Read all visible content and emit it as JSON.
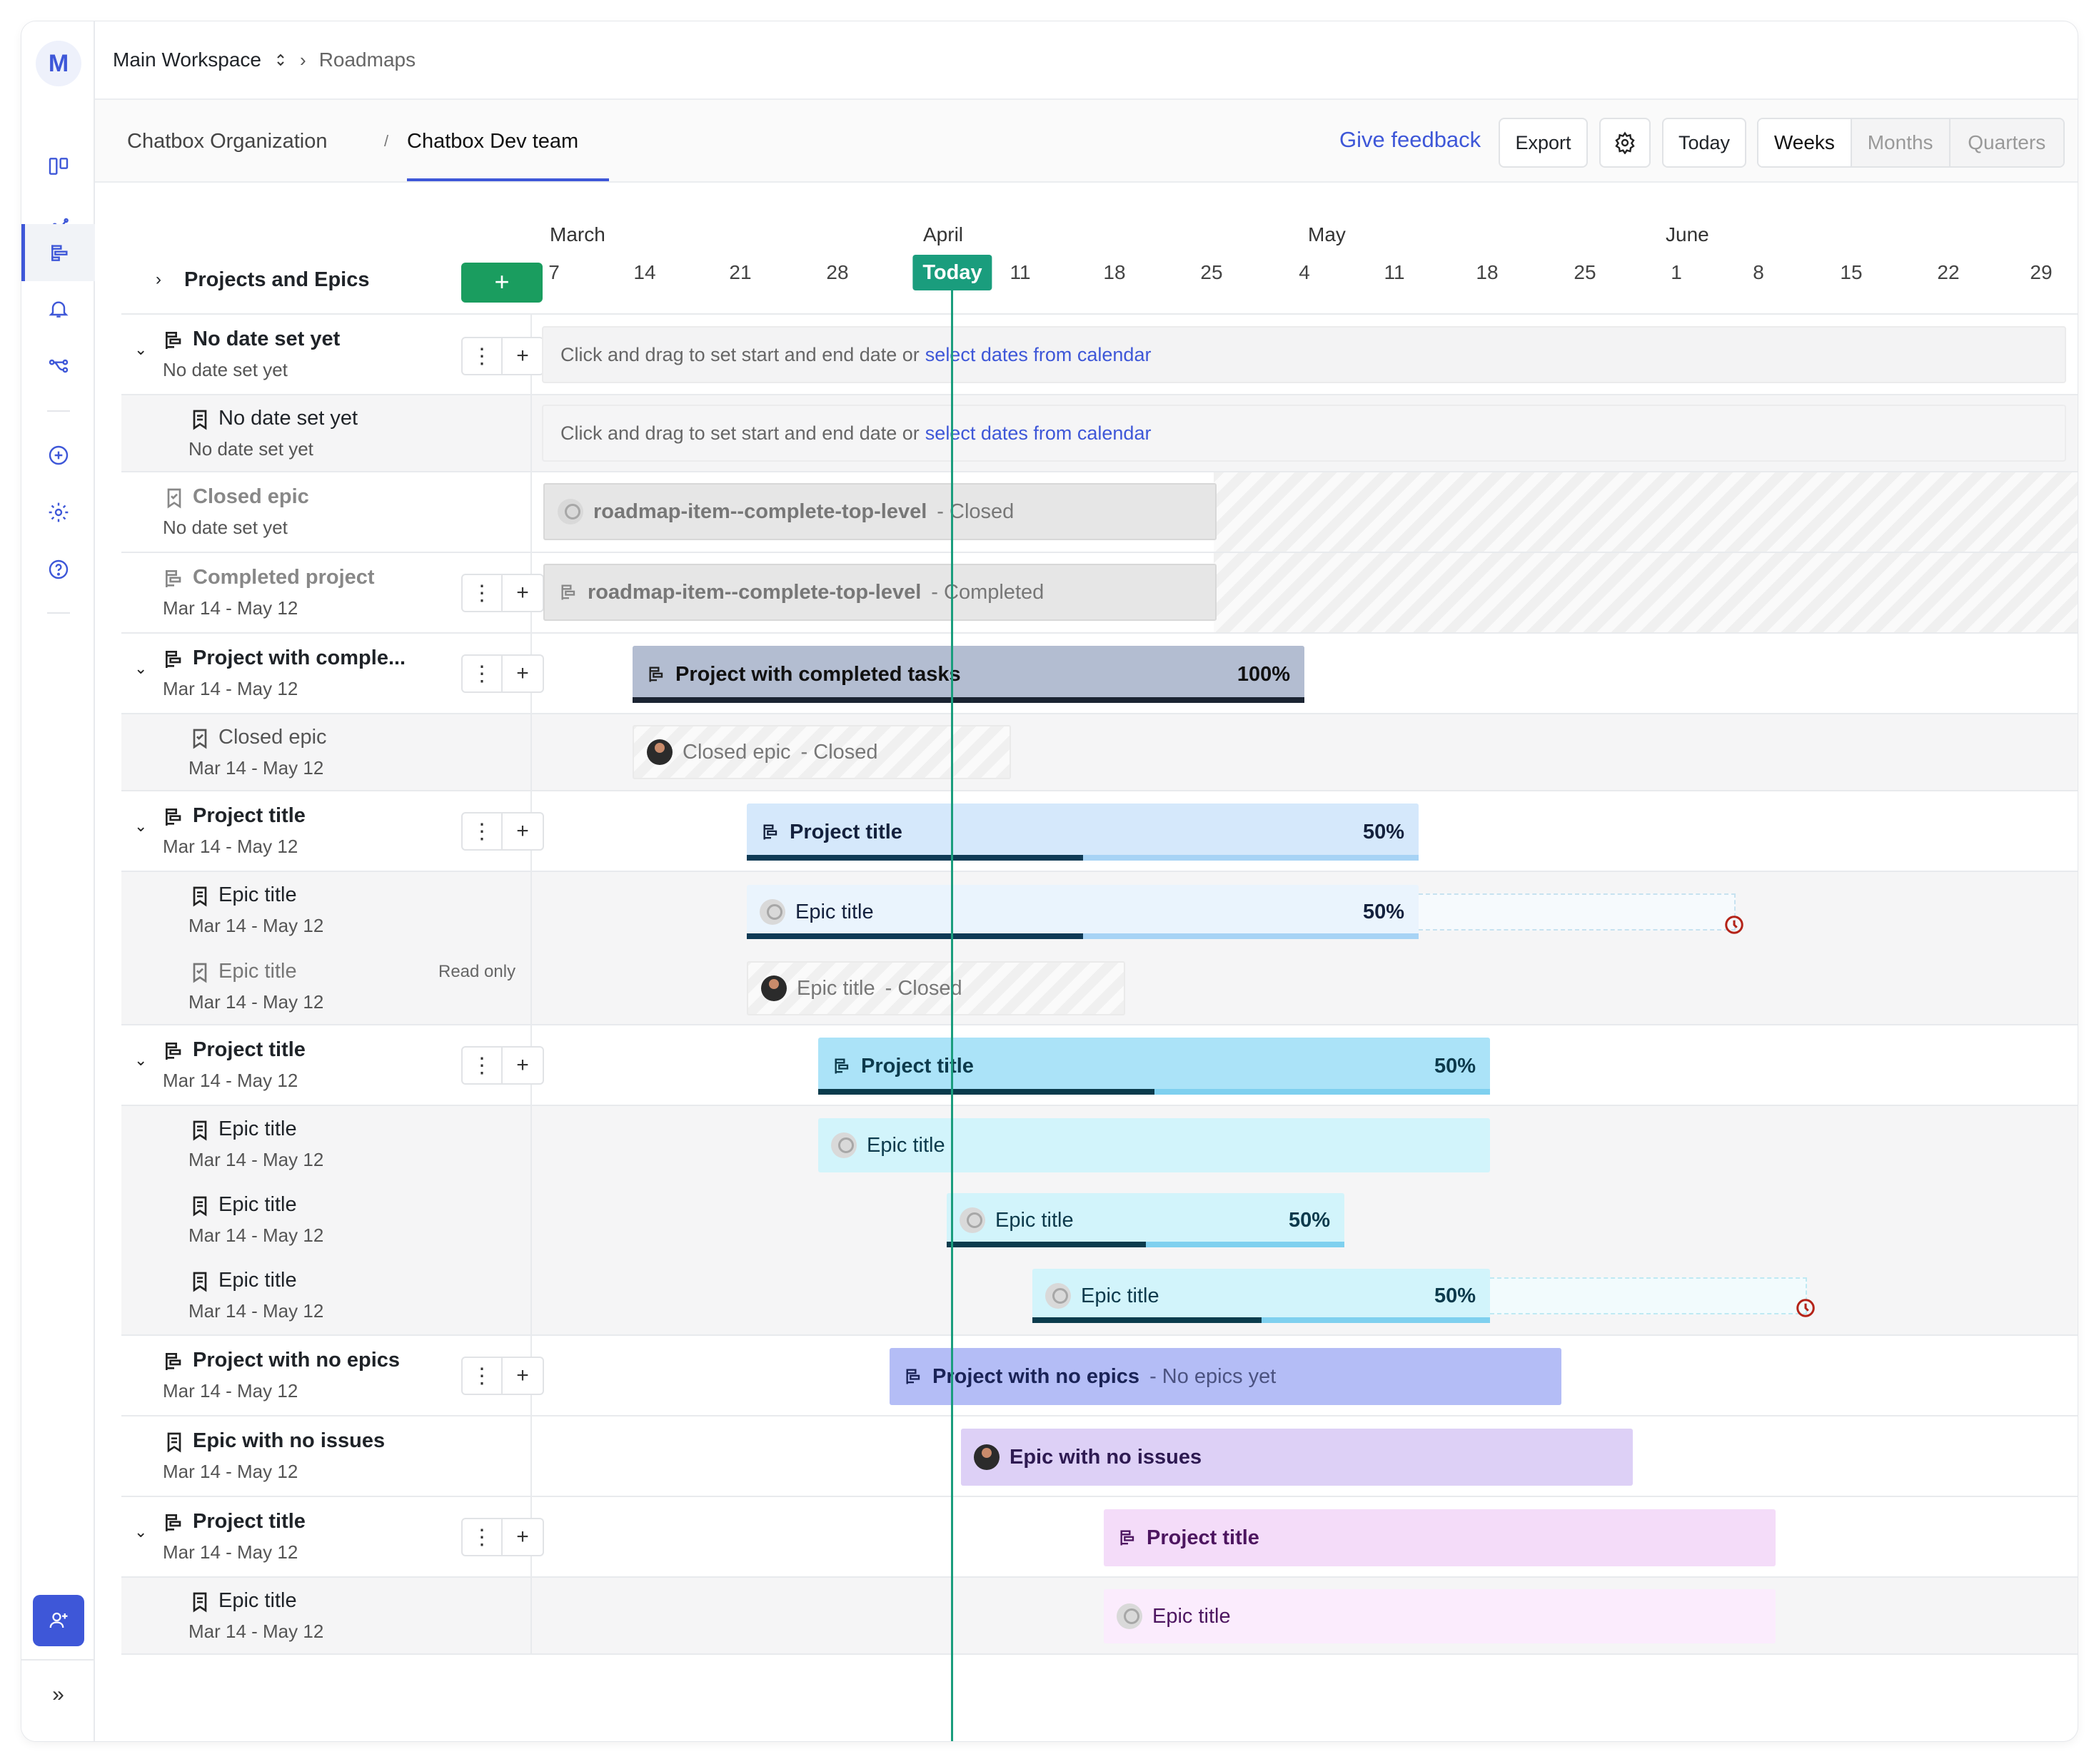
{
  "rail": {
    "workspace_initial": "M",
    "items": [
      {
        "icon": "board-icon"
      },
      {
        "icon": "analytics-icon"
      },
      {
        "icon": "roadmap-icon",
        "active": true
      },
      {
        "icon": "bell-icon"
      },
      {
        "icon": "workflow-icon"
      },
      {
        "icon": "add-circle-icon"
      },
      {
        "icon": "settings-icon"
      },
      {
        "icon": "help-icon"
      }
    ],
    "invite_icon": "invite-user-icon",
    "expand_label": "»"
  },
  "topbar": {
    "workspace": "Main Workspace",
    "crumb": "Roadmaps"
  },
  "subbar": {
    "tabs": [
      "Chatbox Organization",
      "/",
      "Chatbox Dev team"
    ],
    "give_feedback": "Give feedback",
    "export": "Export",
    "today": "Today",
    "views": [
      "Weeks",
      "Months",
      "Quarters"
    ],
    "active_view": "Weeks"
  },
  "timeline": {
    "header_title": "Projects and Epics",
    "add_label": "+",
    "months": [
      "March",
      "April",
      "May",
      "June"
    ],
    "days": [
      "7",
      "14",
      "21",
      "28",
      "4",
      "11",
      "18",
      "25",
      "4",
      "11",
      "18",
      "25",
      "1",
      "8",
      "15",
      "22",
      "29"
    ],
    "today_label": "Today"
  },
  "rows": [
    {
      "title": "No date set yet",
      "date": "No date set yet"
    },
    {
      "title": "No date set yet",
      "date": "No date set yet"
    },
    {
      "title": "Closed epic",
      "date": "No date set yet"
    },
    {
      "title": "Completed project",
      "date": "Mar 14 - May 12"
    },
    {
      "title": "Project with comple...",
      "date": "Mar 14 - May 12"
    },
    {
      "title": "Closed epic",
      "date": "Mar 14 - May 12"
    },
    {
      "title": "Project title",
      "date": "Mar 14 - May 12"
    },
    {
      "title": "Epic title",
      "date": "Mar 14 - May 12"
    },
    {
      "title": "Epic title",
      "date": "Mar 14 - May 12",
      "badge": "Read only"
    },
    {
      "title": "Project title",
      "date": "Mar 14 - May 12"
    },
    {
      "title": "Epic title",
      "date": "Mar 14 - May 12"
    },
    {
      "title": "Epic title",
      "date": "Mar 14 - May 12"
    },
    {
      "title": "Epic title",
      "date": "Mar 14 - May 12"
    },
    {
      "title": "Project with no epics",
      "date": "Mar 14 - May 12"
    },
    {
      "title": "Epic with no issues",
      "date": "Mar 14 - May 12"
    },
    {
      "title": "Project title",
      "date": "Mar 14 - May 12"
    },
    {
      "title": "Epic title",
      "date": "Mar 14 - May 12"
    }
  ],
  "nodate_hint": {
    "text": "Click and drag to set start and end date or",
    "link": "select dates from calendar"
  },
  "bars": [
    {
      "label": "roadmap-item--complete-top-level",
      "suffix": "- Closed"
    },
    {
      "label": "roadmap-item--complete-top-level",
      "suffix": "- Completed"
    },
    {
      "label": "Project with completed tasks",
      "pct": "100%",
      "progress": 1.0
    },
    {
      "label": "Closed epic",
      "suffix": "- Closed"
    },
    {
      "label": "Project title",
      "pct": "50%",
      "progress": 0.5
    },
    {
      "label": "Epic title",
      "pct": "50%",
      "progress": 0.5
    },
    {
      "label": "Epic title",
      "suffix": "- Closed"
    },
    {
      "label": "Project title",
      "pct": "50%",
      "progress": 0.5
    },
    {
      "label": "Epic title"
    },
    {
      "label": "Epic title",
      "pct": "50%",
      "progress": 0.5
    },
    {
      "label": "Epic title",
      "pct": "50%",
      "progress": 0.5
    },
    {
      "label": "Project with no epics",
      "suffix": "- No epics yet"
    },
    {
      "label": "Epic with no issues"
    },
    {
      "label": "Project title"
    },
    {
      "label": "Epic title"
    }
  ],
  "colors": {
    "accent": "#3e57d8",
    "today": "#1a9d7d",
    "add_button": "#1a9d5f",
    "overdue": "#b42318"
  }
}
